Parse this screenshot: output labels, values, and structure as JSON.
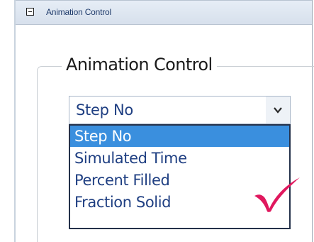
{
  "header": {
    "title": "Animation Control",
    "toggle_icon": "collapse-minus-icon"
  },
  "group": {
    "title": "Animation Control"
  },
  "combo": {
    "selected": "Step No",
    "arrow_icon": "chevron-down-icon"
  },
  "dropdown": {
    "options": [
      "Step No",
      "Simulated Time",
      "Percent Filled",
      "Fraction Solid"
    ],
    "highlighted_index": 0
  },
  "annotation": {
    "icon": "checkmark-icon",
    "color": "#e0185e"
  },
  "colors": {
    "highlight": "#3a8fde",
    "option_text": "#1f3f82",
    "header_bg": "#dde6f1"
  }
}
